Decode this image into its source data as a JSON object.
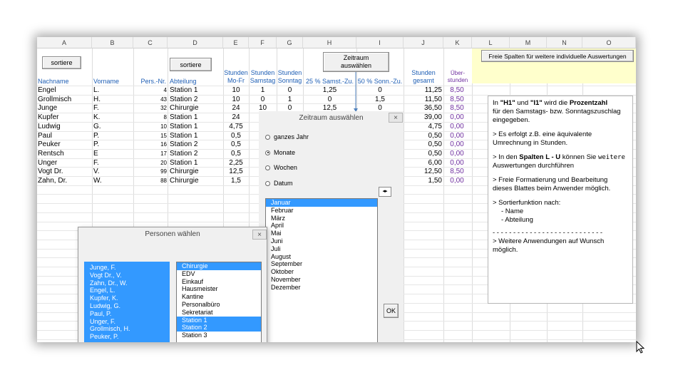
{
  "columns": [
    "A",
    "B",
    "C",
    "D",
    "E",
    "F",
    "G",
    "H",
    "I",
    "J",
    "K",
    "L",
    "M",
    "N",
    "O"
  ],
  "buttons": {
    "sortiere_a": "sortiere",
    "sortiere_d": "sortiere",
    "zeitraum_line1": "Zeitraum",
    "zeitraum_line2": "auswählen",
    "free_columns": "Freie Spalten für weitere individuelle Auswertungen"
  },
  "headers": {
    "nachname": "Nachname",
    "vorname": "Vorname",
    "persnr": "Pers.-Nr.",
    "abteilung": "Abteilung",
    "stunden_mofr_1": "Stunden",
    "stunden_mofr_2": "Mo-Fr",
    "stunden_sa_1": "Stunden",
    "stunden_sa_2": "Samstag",
    "stunden_so_1": "Stunden",
    "stunden_so_2": "Sonntag",
    "samst_zu": "25 % Samst.-Zu.",
    "sonn_zu": "50 % Sonn.-Zu.",
    "gesamt_1": "Stunden",
    "gesamt_2": "gesamt",
    "ueber_1": "Über-",
    "ueber_2": "stunden"
  },
  "rows": [
    {
      "nachname": "Engel",
      "vorname": "L.",
      "persnr": "4",
      "abteilung": "Station 1",
      "mofr": "10",
      "sa": "1",
      "so": "0",
      "h": "1,25",
      "i": "0",
      "gesamt": "11,25",
      "ueber": "8,50"
    },
    {
      "nachname": "Grollmisch",
      "vorname": "H.",
      "persnr": "43",
      "abteilung": "Station 2",
      "mofr": "10",
      "sa": "0",
      "so": "1",
      "h": "0",
      "i": "1,5",
      "gesamt": "11,50",
      "ueber": "8,50"
    },
    {
      "nachname": "Junge",
      "vorname": "F.",
      "persnr": "32",
      "abteilung": "Chirurgie",
      "mofr": "24",
      "sa": "10",
      "so": "0",
      "h": "12,5",
      "i": "0",
      "gesamt": "36,50",
      "ueber": "8,50"
    },
    {
      "nachname": "Kupfer",
      "vorname": "K.",
      "persnr": "8",
      "abteilung": "Station 1",
      "mofr": "24",
      "sa": "",
      "so": "",
      "h": "",
      "i": "",
      "gesamt": "39,00",
      "ueber": "0,00"
    },
    {
      "nachname": "Ludwig",
      "vorname": "G.",
      "persnr": "10",
      "abteilung": "Station 1",
      "mofr": "4,75",
      "sa": "",
      "so": "",
      "h": "",
      "i": "",
      "gesamt": "4,75",
      "ueber": "0,00"
    },
    {
      "nachname": "Paul",
      "vorname": "P.",
      "persnr": "15",
      "abteilung": "Station 1",
      "mofr": "0,5",
      "sa": "",
      "so": "",
      "h": "",
      "i": "",
      "gesamt": "0,50",
      "ueber": "0,00"
    },
    {
      "nachname": "Peuker",
      "vorname": "P.",
      "persnr": "16",
      "abteilung": "Station 2",
      "mofr": "0,5",
      "sa": "",
      "so": "",
      "h": "",
      "i": "",
      "gesamt": "0,50",
      "ueber": "0,00"
    },
    {
      "nachname": "Rentsch",
      "vorname": "E",
      "persnr": "17",
      "abteilung": "Station 2",
      "mofr": "0,5",
      "sa": "",
      "so": "",
      "h": "",
      "i": "",
      "gesamt": "0,50",
      "ueber": "0,00"
    },
    {
      "nachname": "Unger",
      "vorname": "F.",
      "persnr": "20",
      "abteilung": "Station 1",
      "mofr": "2,25",
      "sa": "",
      "so": "",
      "h": "",
      "i": "",
      "gesamt": "6,00",
      "ueber": "0,00"
    },
    {
      "nachname": "Vogt Dr.",
      "vorname": "V.",
      "persnr": "99",
      "abteilung": "Chirurgie",
      "mofr": "12,5",
      "sa": "",
      "so": "",
      "h": "",
      "i": "",
      "gesamt": "12,50",
      "ueber": "8,50"
    },
    {
      "nachname": "Zahn, Dr.",
      "vorname": "W.",
      "persnr": "88",
      "abteilung": "Chirurgie",
      "mofr": "1,5",
      "sa": "",
      "so": "",
      "h": "",
      "i": "",
      "gesamt": "1,50",
      "ueber": "0,00"
    }
  ],
  "zeitraum_dialog": {
    "title": "Zeitraum auswählen",
    "close": "×",
    "options": [
      "ganzes Jahr",
      "Monate",
      "Wochen",
      "Datum"
    ],
    "selected_option": "Monate",
    "months": [
      "Januar",
      "Februar",
      "März",
      "April",
      "Mai",
      "Juni",
      "Juli",
      "August",
      "September",
      "Oktober",
      "November",
      "Dezember"
    ],
    "selected_month": "Januar",
    "ok": "OK"
  },
  "personen_dialog": {
    "title": "Personen wählen",
    "close": "×",
    "persons": [
      "Junge, F.",
      "Vogt Dr., V.",
      "Zahn, Dr., W.",
      "Engel, L.",
      "Kupfer, K.",
      "Ludwig, G.",
      "Paul, P.",
      "Unger, F.",
      "Grollmisch, H.",
      "Peuker, P."
    ],
    "departments": [
      "Chirurgie",
      "EDV",
      "Einkauf",
      "Hausmeister",
      "Kantine",
      "Personalbüro",
      "Sekretariat",
      "Station 1",
      "Station 2",
      "Station 3"
    ],
    "selected_departments": [
      "Chirurgie",
      "Station 1",
      "Station 2"
    ]
  },
  "info": {
    "p1_a": "In ",
    "p1_b": "\"H1\"",
    "p1_c": " und ",
    "p1_d": "\"I1\"",
    "p1_e": " wird die ",
    "p1_f": "Prozentzahl",
    "p1_g": "für den Samstags- bzw. Sonntagszuschlag eingegeben.",
    "p2": "> Es erfolgt z.B. eine äquivalente Umrechnung in Stunden.",
    "p3_a": "> In den ",
    "p3_b": "Spalten L - U",
    "p3_c": "  können Sie ",
    "p3_d": "weitere",
    "p3_e": " Auswertungen durchführen",
    "p4": "> Freie Formatierung und Bearbeitung dieses Blattes beim Anwender möglich.",
    "p5": "> Sortierfunktion nach:",
    "p5_item1": "-  Name",
    "p5_item2": "-  Abteilung",
    "divider": "- - - - - - - - - - - - - - - - - - - - - - - - - - -",
    "p6": "> Weitere Anwendungen auf Wunsch möglich."
  },
  "colors": {
    "accent_blue": "#3399ff",
    "header_blue": "#1f5fb5",
    "purple": "#7030a0",
    "yellow": "#ffffcc"
  }
}
